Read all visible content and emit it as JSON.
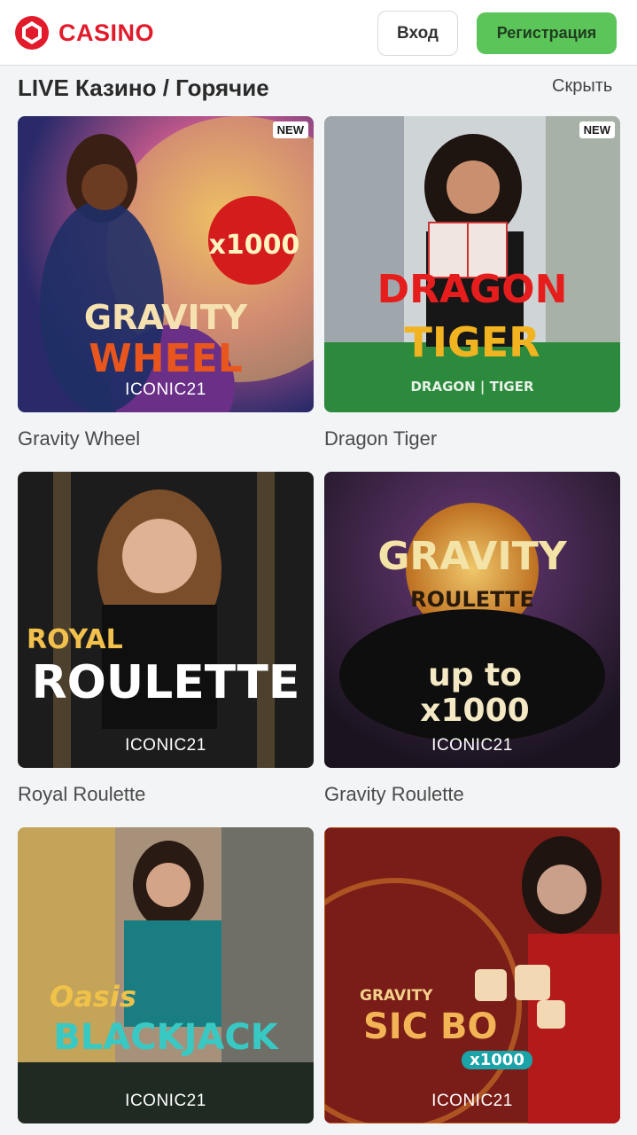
{
  "header": {
    "brand": "CASINO",
    "login_label": "Вход",
    "register_label": "Регистрация",
    "brand_color": "#e21b2c",
    "accent_green": "#5cc55a"
  },
  "section": {
    "title": "LIVE Казино / Горячие",
    "hide_label": "Скрыть"
  },
  "games": [
    {
      "name": "Gravity Wheel",
      "provider": "ICONIC21",
      "badge": "NEW",
      "art_line1": "GRAVITY",
      "art_line2": "WHEEL",
      "art_extra": "x1000"
    },
    {
      "name": "Dragon Tiger",
      "provider": "ICONIC21",
      "badge": "NEW",
      "art_line1": "DRAGON",
      "art_line2": "TIGER",
      "art_extra": "DRAGON | TIGER"
    },
    {
      "name": "Royal Roulette",
      "provider": "ICONIC21",
      "badge": "",
      "art_line1": "ROYAL",
      "art_line2": "ROULETTE",
      "art_extra": ""
    },
    {
      "name": "Gravity Roulette",
      "provider": "ICONIC21",
      "badge": "",
      "art_line1": "GRAVITY",
      "art_line2": "ROULETTE",
      "art_extra": "up to x1000"
    },
    {
      "name": "",
      "provider": "ICONIC21",
      "badge": "",
      "art_line1": "Oasis",
      "art_line2": "BLACKJACK",
      "art_extra": ""
    },
    {
      "name": "",
      "provider": "ICONIC21",
      "badge": "",
      "art_line1": "GRAVITY",
      "art_line2": "SIC BO",
      "art_extra": "x1000"
    }
  ]
}
